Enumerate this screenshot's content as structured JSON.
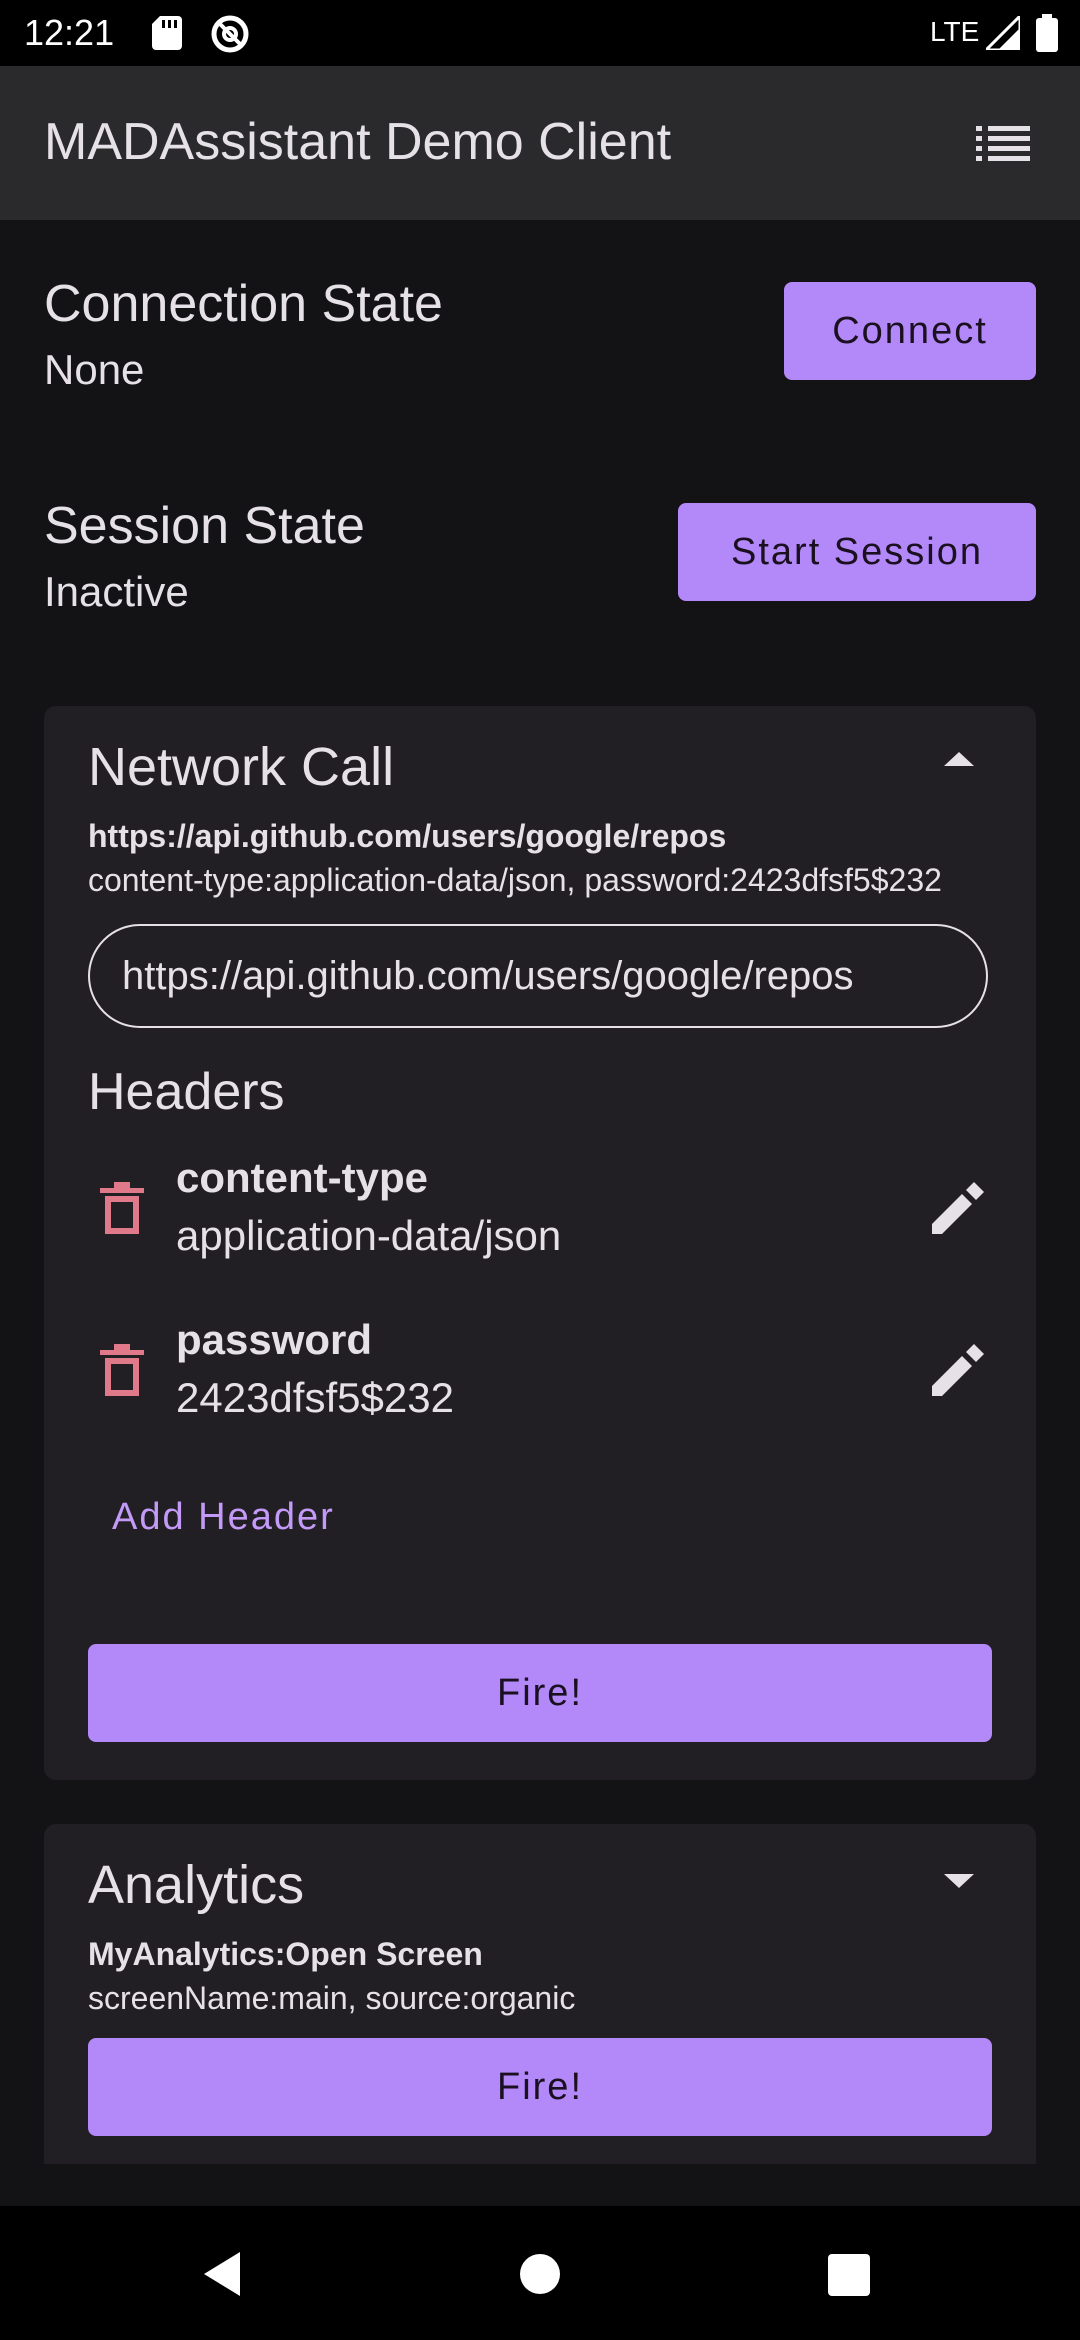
{
  "status_bar": {
    "time": "12:21",
    "network": "LTE",
    "icons": [
      "sd-card-icon",
      "ring-icon",
      "signal-icon",
      "battery-icon"
    ]
  },
  "app_bar": {
    "title": "MADAssistant Demo Client",
    "menu_icon": "list-icon"
  },
  "connection": {
    "label": "Connection State",
    "value": "None",
    "button": "Connect"
  },
  "session": {
    "label": "Session State",
    "value": "Inactive",
    "button": "Start Session"
  },
  "network_card": {
    "title": "Network Call",
    "url_bold": "https://api.github.com/users/google/repos",
    "headers_summary": "content-type:application-data/json, password:2423dfsf5$232",
    "url_input": "https://api.github.com/users/google/repos",
    "headers_title": "Headers",
    "headers": [
      {
        "key": "content-type",
        "value": "application-data/json"
      },
      {
        "key": "password",
        "value": "2423dfsf5$232"
      }
    ],
    "add_header": "Add Header",
    "fire": "Fire!"
  },
  "analytics_card": {
    "title": "Analytics",
    "event": "MyAnalytics:Open Screen",
    "params": "screenName:main, source:organic",
    "fire": "Fire!"
  },
  "colors": {
    "accent": "#b388f9",
    "delete": "#e07a8a",
    "background": "#131215",
    "card": "#211f23"
  }
}
